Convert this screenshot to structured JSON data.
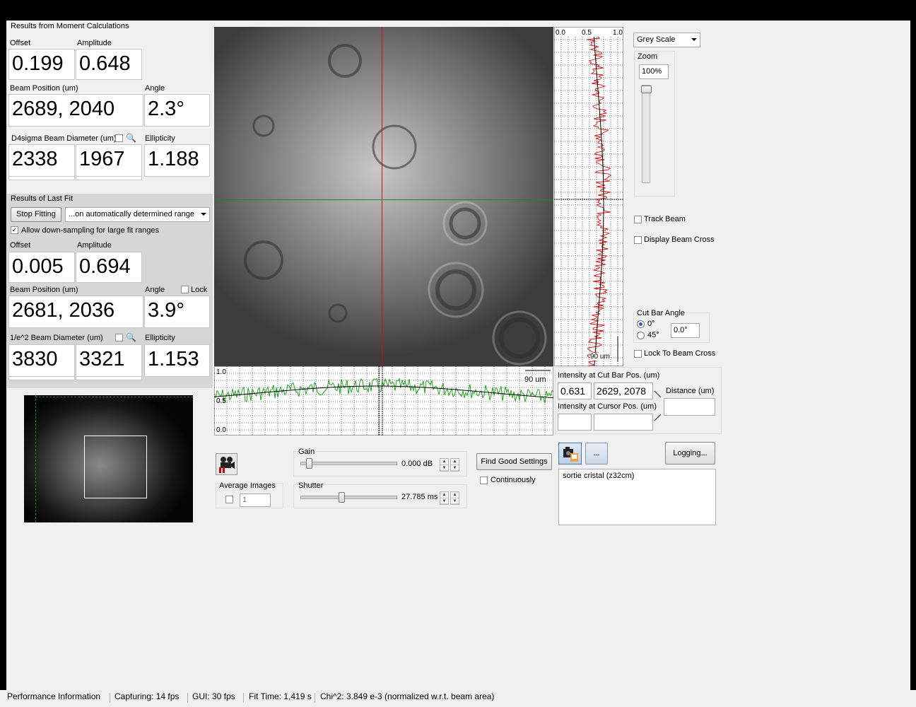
{
  "moment": {
    "title": "Results from Moment Calculations",
    "offset_label": "Offset",
    "offset": "0.199",
    "amplitude_label": "Amplitude",
    "amplitude": "0.648",
    "beam_pos_label": "Beam Position (um)",
    "beam_pos": "2689, 2040",
    "angle_label": "Angle",
    "angle": "2.3°",
    "diam_label": "D4sigma Beam Diameter (um)",
    "diam_x": "2338",
    "diam_y": "1967",
    "ellipticity_label": "Ellipticity",
    "ellipticity": "1.188"
  },
  "fit": {
    "title": "Results of Last Fit",
    "stop_button": "Stop Fitting",
    "range_select": "...on automatically determined range",
    "downsample_label": "Allow down-sampling for large fit ranges",
    "downsample_checked": true,
    "offset_label": "Offset",
    "offset": "0.005",
    "amplitude_label": "Amplitude",
    "amplitude": "0.694",
    "beam_pos_label": "Beam Position (um)",
    "beam_pos": "2681, 2036",
    "angle_label": "Angle",
    "angle": "3.9°",
    "lock_label": "Lock",
    "diam_label": "1/e^2 Beam Diameter (um)",
    "diam_x": "3830",
    "diam_y": "3321",
    "ellipticity_label": "Ellipticity",
    "ellipticity": "1.153"
  },
  "profile_v": {
    "tick0": "0.0",
    "tick05": "0.5",
    "tick1": "1.0",
    "scale": "90 um"
  },
  "profile_h": {
    "tick1": "1.0",
    "tick05": "0.5",
    "tick0": "0.0",
    "scale": "90 um"
  },
  "display": {
    "colormap": "Grey Scale",
    "zoom_label": "Zoom",
    "zoom": "100%",
    "track_beam": "Track Beam",
    "display_beam_cross": "Display Beam Cross",
    "cut_bar_angle": "Cut Bar Angle",
    "angle_0": "0°",
    "angle_45": "45°",
    "angle_value": "0.0°",
    "lock_to_beam_cross": "Lock To Beam Cross"
  },
  "intensity": {
    "cut_bar_label": "Intensity at Cut Bar Pos. (um)",
    "cut_value": "0.631",
    "cut_pos": "2629, 2078",
    "distance_label": "Distance (um)",
    "cursor_label": "Intensity at Cursor Pos. (um)"
  },
  "camera": {
    "average_label": "Average Images",
    "average_value": "1",
    "gain_label": "Gain",
    "gain_value": "0.000 dB",
    "gain_level": 0.06,
    "shutter_label": "Shutter",
    "shutter_value": "27.785 ms",
    "shutter_level": 0.4,
    "find_settings": "Find Good Settings",
    "continuously": "Continuously"
  },
  "log": {
    "more_button": "...",
    "logging_button": "Logging...",
    "comment": "sortie cristal (z32cm)"
  },
  "status": {
    "perf": "Performance Information",
    "capturing": "Capturing: 14 fps",
    "gui": "GUI: 30 fps",
    "fit_time": "Fit Time: 1,419 s",
    "chi": "Chi^2:  3.849 e-3  (normalized w.r.t. beam area)"
  },
  "colors": {
    "cross_v": "#d01010",
    "cross_h": "#109010",
    "trace_v": "#d01010",
    "trace_h": "#119911"
  }
}
